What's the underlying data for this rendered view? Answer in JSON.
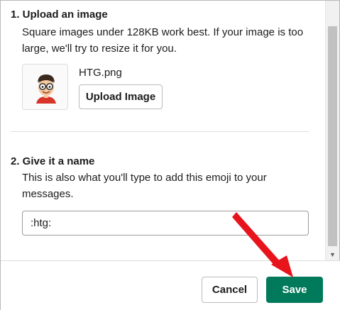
{
  "upload_section": {
    "title": "1. Upload an image",
    "description": "Square images under 128KB work best. If your image is too large, we'll try to resize it for you.",
    "thumbnail_icon": "cartoon-face-icon",
    "file_name": "HTG.png",
    "upload_label": "Upload Image"
  },
  "name_section": {
    "title": "2. Give it a name",
    "description": "This is also what you'll type to add this emoji to your messages.",
    "input_value": ":htg:"
  },
  "footer": {
    "cancel_label": "Cancel",
    "save_label": "Save"
  },
  "colors": {
    "save_button": "#007a5a",
    "annotation_arrow": "#e8141c"
  },
  "icons": {
    "scroll_down": "chevron-down-icon",
    "annotation": "red-arrow-icon"
  }
}
